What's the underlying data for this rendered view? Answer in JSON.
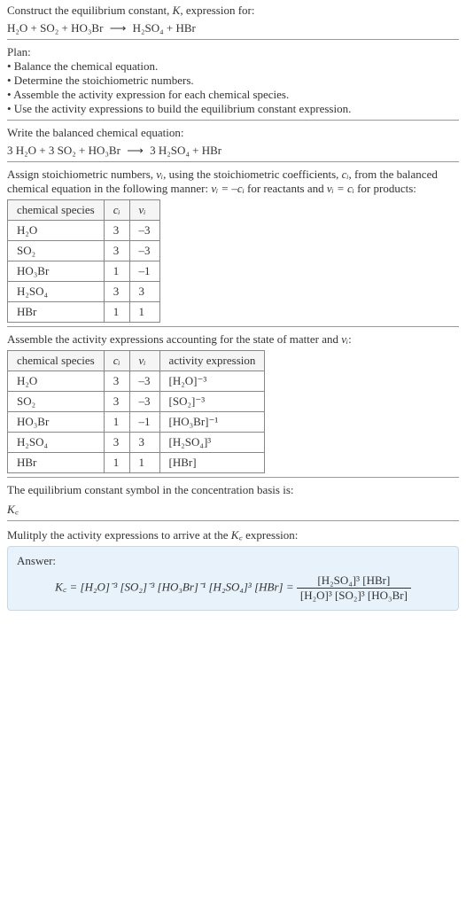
{
  "top": {
    "header_line1": "Construct the equilibrium constant, ",
    "header_K": "K",
    "header_line1_b": ", expression for:",
    "eq_lhs": "H₂O + SO₂ + HO₃Br",
    "eq_arrow": "⟶",
    "eq_rhs": "H₂SO₄ + HBr"
  },
  "plan": {
    "title": "Plan:",
    "b1": "• Balance the chemical equation.",
    "b2": "• Determine the stoichiometric numbers.",
    "b3": "• Assemble the activity expression for each chemical species.",
    "b4": "• Use the activity expressions to build the equilibrium constant expression."
  },
  "balanced": {
    "title": "Write the balanced chemical equation:",
    "lhs": "3 H₂O + 3 SO₂ + HO₃Br",
    "arrow": "⟶",
    "rhs": "3 H₂SO₄ + HBr"
  },
  "stoich": {
    "intro_a": "Assign stoichiometric numbers, ",
    "nu": "νᵢ",
    "intro_b": ", using the stoichiometric coefficients, ",
    "ci": "cᵢ",
    "intro_c": ", from the balanced chemical equation in the following manner: ",
    "rel1": "νᵢ = –cᵢ",
    "intro_d": " for reactants and ",
    "rel2": "νᵢ = cᵢ",
    "intro_e": " for products:",
    "head_species": "chemical species",
    "head_ci": "cᵢ",
    "head_nu": "νᵢ",
    "rows": [
      {
        "sp": "H₂O",
        "c": "3",
        "v": "–3"
      },
      {
        "sp": "SO₂",
        "c": "3",
        "v": "–3"
      },
      {
        "sp": "HO₃Br",
        "c": "1",
        "v": "–1"
      },
      {
        "sp": "H₂SO₄",
        "c": "3",
        "v": "3"
      },
      {
        "sp": "HBr",
        "c": "1",
        "v": "1"
      }
    ]
  },
  "activity": {
    "intro_a": "Assemble the activity expressions accounting for the state of matter and ",
    "nu": "νᵢ",
    "intro_b": ":",
    "head_species": "chemical species",
    "head_ci": "cᵢ",
    "head_nu": "νᵢ",
    "head_act": "activity expression",
    "rows": [
      {
        "sp": "H₂O",
        "c": "3",
        "v": "–3",
        "act": "[H₂O]⁻³"
      },
      {
        "sp": "SO₂",
        "c": "3",
        "v": "–3",
        "act": "[SO₂]⁻³"
      },
      {
        "sp": "HO₃Br",
        "c": "1",
        "v": "–1",
        "act": "[HO₃Br]⁻¹"
      },
      {
        "sp": "H₂SO₄",
        "c": "3",
        "v": "3",
        "act": "[H₂SO₄]³"
      },
      {
        "sp": "HBr",
        "c": "1",
        "v": "1",
        "act": "[HBr]"
      }
    ]
  },
  "kcdef": {
    "line": "The equilibrium constant symbol in the concentration basis is:",
    "sym": "K꜀"
  },
  "mult": {
    "line_a": "Mulitply the activity expressions to arrive at the ",
    "kc": "K꜀",
    "line_b": " expression:"
  },
  "answer": {
    "label": "Answer:",
    "lhs": "K꜀ = [H₂O]⁻³ [SO₂]⁻³ [HO₃Br]⁻¹ [H₂SO₄]³ [HBr] = ",
    "num": "[H₂SO₄]³ [HBr]",
    "den": "[H₂O]³ [SO₂]³ [HO₃Br]"
  },
  "chart_data": {
    "type": "table",
    "tables": [
      {
        "title": "stoichiometric numbers",
        "columns": [
          "chemical species",
          "cᵢ",
          "νᵢ"
        ],
        "rows": [
          [
            "H₂O",
            3,
            -3
          ],
          [
            "SO₂",
            3,
            -3
          ],
          [
            "HO₃Br",
            1,
            -1
          ],
          [
            "H₂SO₄",
            3,
            3
          ],
          [
            "HBr",
            1,
            1
          ]
        ]
      },
      {
        "title": "activity expressions",
        "columns": [
          "chemical species",
          "cᵢ",
          "νᵢ",
          "activity expression"
        ],
        "rows": [
          [
            "H₂O",
            3,
            -3,
            "[H₂O]^-3"
          ],
          [
            "SO₂",
            3,
            -3,
            "[SO₂]^-3"
          ],
          [
            "HO₃Br",
            1,
            -1,
            "[HO₃Br]^-1"
          ],
          [
            "H₂SO₄",
            3,
            3,
            "[H₂SO₄]^3"
          ],
          [
            "HBr",
            1,
            1,
            "[HBr]"
          ]
        ]
      }
    ]
  }
}
